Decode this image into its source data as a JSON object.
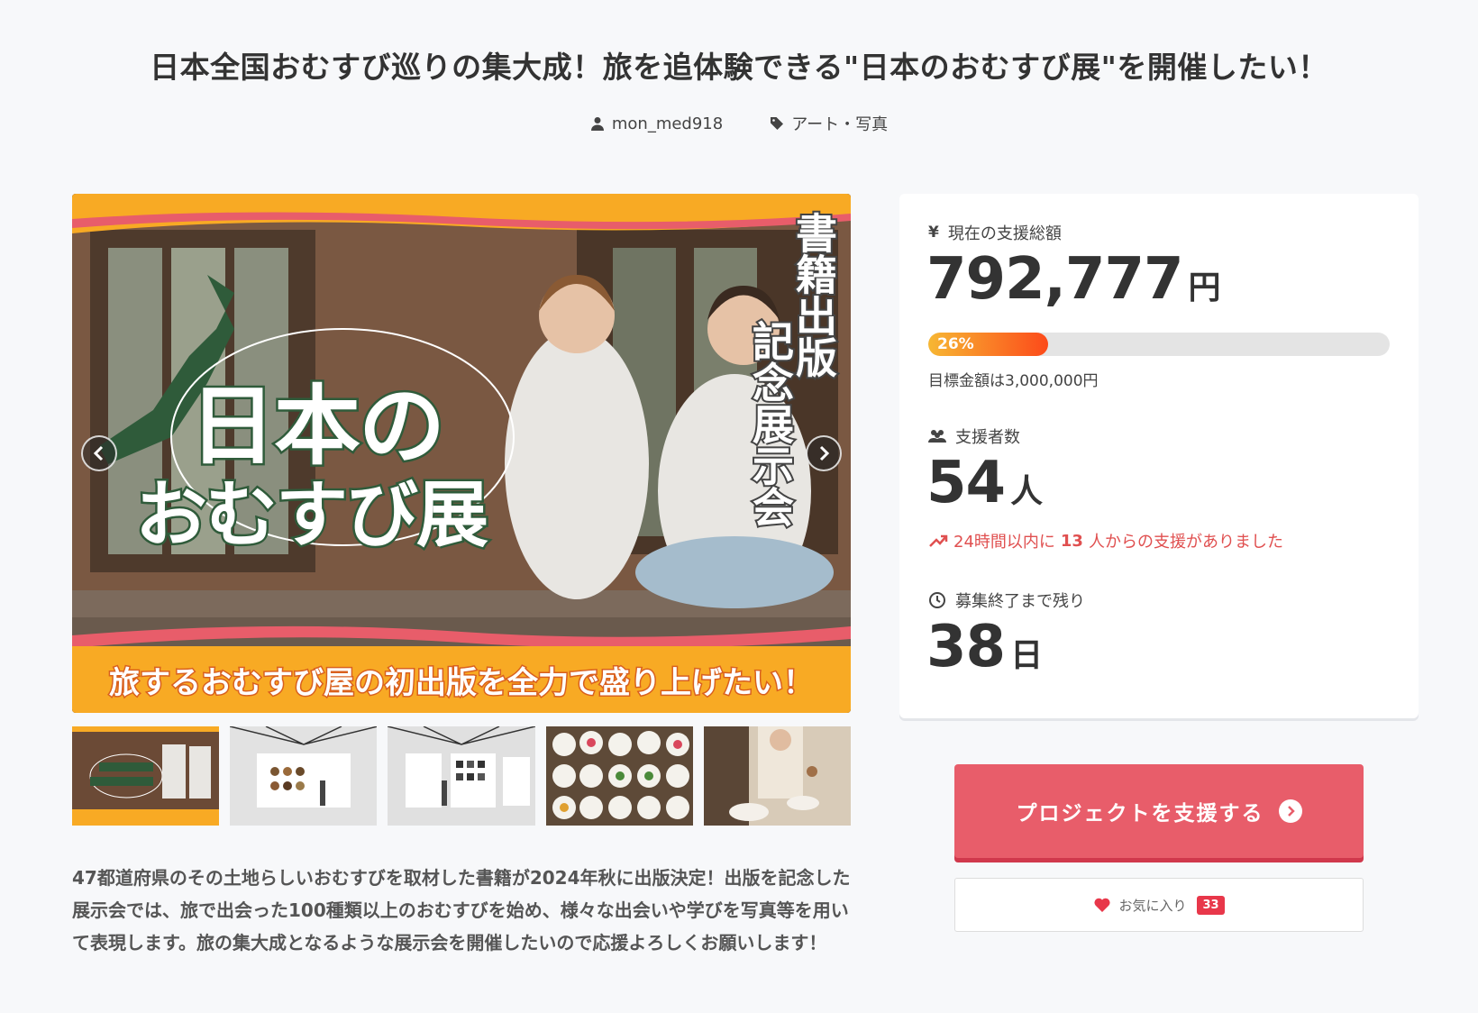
{
  "project": {
    "title": "日本全国おむすび巡りの集大成！旅を追体験できる\"日本のおむすび展\"を開催したい！",
    "author": "mon_med918",
    "category": "アート・写真",
    "icons": {
      "author": "user-icon",
      "category": "tag-icon"
    }
  },
  "hero": {
    "title_line1": "日本の",
    "title_line2": "おむすび展",
    "vertical_line1": "書籍出版",
    "vertical_line2": "記念展示会",
    "banner": "旅するおむすび屋の初出版を全力で盛り上げたい！",
    "prev_icon": "chevron-left-icon",
    "next_icon": "chevron-right-icon"
  },
  "thumbnails": [
    {
      "name": "thumbnail-main-visual"
    },
    {
      "name": "thumbnail-exhibition-1"
    },
    {
      "name": "thumbnail-exhibition-2"
    },
    {
      "name": "thumbnail-onigiri"
    },
    {
      "name": "thumbnail-kitchen"
    }
  ],
  "description": "47都道府県のその土地らしいおむすびを取材した書籍が2024年秋に出版決定！出版を記念した展示会では、旅で出会った100種類以上のおむすびを始め、様々な出会いや学びを写真等を用いて表現します。旅の集大成となるような展示会を開催したいので応援よろしくお願いします！",
  "stats": {
    "amount_label": "現在の支援総額",
    "amount": "792,777",
    "amount_unit": "円",
    "progress_text": "26%",
    "progress_fraction": 0.26,
    "goal": "目標金額は3,000,000円",
    "supporters_label": "支援者数",
    "supporters": "54",
    "supporters_unit": "人",
    "trend_prefix": "24時間以内に",
    "trend_count": "13",
    "trend_suffix": "人からの支援がありました",
    "remaining_label": "募集終了まで残り",
    "remaining": "38",
    "remaining_unit": "日"
  },
  "actions": {
    "support_label": "プロジェクトを支援する",
    "favorite_label": "お気に入り",
    "favorite_count": "33"
  },
  "colors": {
    "accent": "#e85d6a",
    "progress_start": "#f7b733",
    "progress_end": "#fc4a1a",
    "trend": "#e05050",
    "banner": "#f8aa24"
  }
}
